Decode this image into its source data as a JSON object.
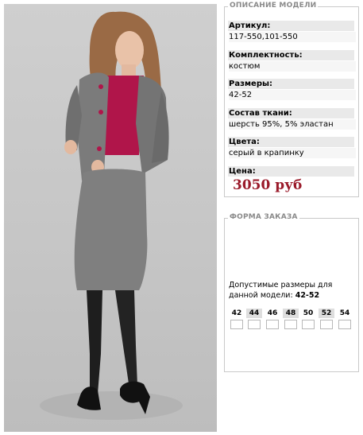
{
  "description": {
    "legend": "ОПИСАНИЕ МОДЕЛИ",
    "article_label": "Артикул:",
    "article_value": "117-550,101-550",
    "set_label": "Комплектность:",
    "set_value": "костюм",
    "sizes_label": "Размеры:",
    "sizes_value": "42-52",
    "fabric_label": "Состав ткани:",
    "fabric_value": "шерсть 95%, 5% эластан",
    "colors_label": "Цвета:",
    "colors_value": "серый в крапинку",
    "price_label": "Цена:",
    "price_value": "3050 руб"
  },
  "order_form": {
    "legend": "ФОРМА ЗАКАЗА",
    "note_text": "Допустимые размеры для данной модели:",
    "note_sizes": "42-52",
    "sizes": [
      "42",
      "44",
      "46",
      "48",
      "50",
      "52",
      "54"
    ]
  },
  "colors": {
    "price": "#9a1a2a",
    "accent_blouse": "#b0154a"
  }
}
